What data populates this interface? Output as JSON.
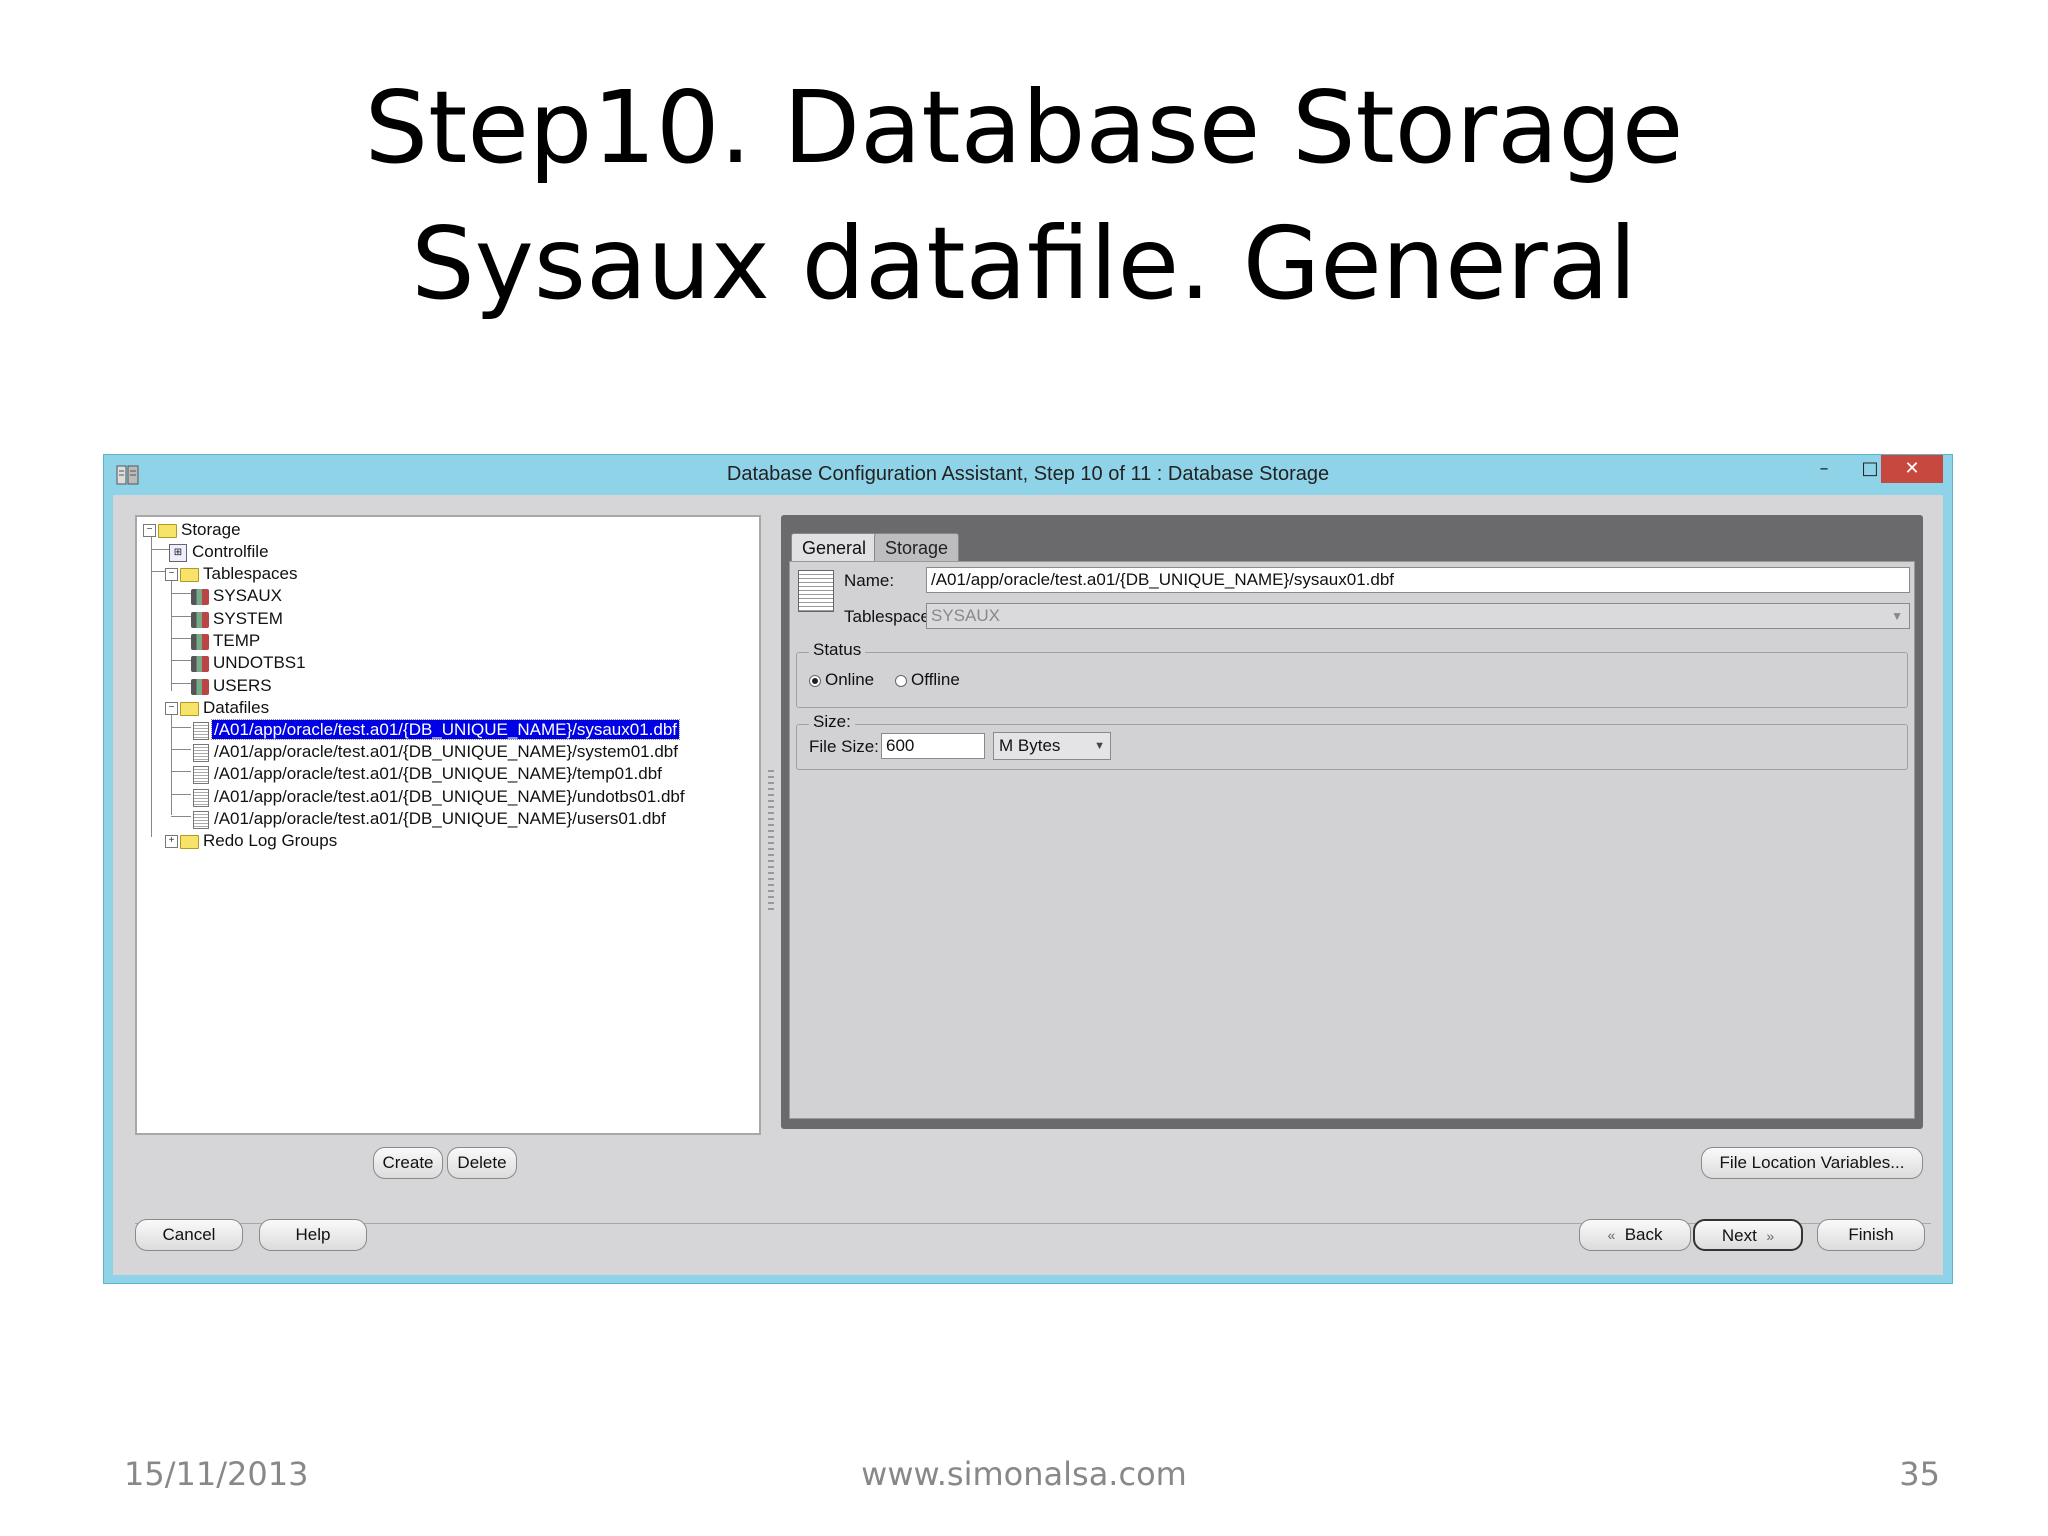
{
  "slide": {
    "title_line1": "Step10. Database Storage",
    "title_line2": "Sysaux datafile. General",
    "footer_date": "15/11/2013",
    "footer_site": "www.simonalsa.com",
    "footer_page": "35"
  },
  "window": {
    "title": "Database Configuration Assistant, Step 10 of 11 : Database Storage",
    "minimize": "–",
    "maximize": "□",
    "close": "✕"
  },
  "tree": {
    "storage": "Storage",
    "controlfile": "Controlfile",
    "tablespaces": "Tablespaces",
    "tablespace_items": [
      "SYSAUX",
      "SYSTEM",
      "TEMP",
      "UNDOTBS1",
      "USERS"
    ],
    "datafiles": "Datafiles",
    "datafile_items": [
      "/A01/app/oracle/test.a01/{DB_UNIQUE_NAME}/sysaux01.dbf",
      "/A01/app/oracle/test.a01/{DB_UNIQUE_NAME}/system01.dbf",
      "/A01/app/oracle/test.a01/{DB_UNIQUE_NAME}/temp01.dbf",
      "/A01/app/oracle/test.a01/{DB_UNIQUE_NAME}/undotbs01.dbf",
      "/A01/app/oracle/test.a01/{DB_UNIQUE_NAME}/users01.dbf"
    ],
    "redo": "Redo Log Groups",
    "selected_index": 0
  },
  "tabs": {
    "general": "General",
    "storage": "Storage"
  },
  "form": {
    "name_label": "Name:",
    "name_value": "/A01/app/oracle/test.a01/{DB_UNIQUE_NAME}/sysaux01.dbf",
    "tablespace_label": "Tablespace:",
    "tablespace_value": "SYSAUX",
    "status_title": "Status",
    "online_label": "Online",
    "offline_label": "Offline",
    "status_selected": "Online",
    "size_title": "Size:",
    "filesize_label": "File Size:",
    "filesize_value": "600",
    "unit_value": "M Bytes"
  },
  "buttons": {
    "create": "Create",
    "delete": "Delete",
    "file_location": "File Location Variables...",
    "cancel": "Cancel",
    "help": "Help",
    "back": "Back",
    "next": "Next",
    "finish": "Finish"
  }
}
